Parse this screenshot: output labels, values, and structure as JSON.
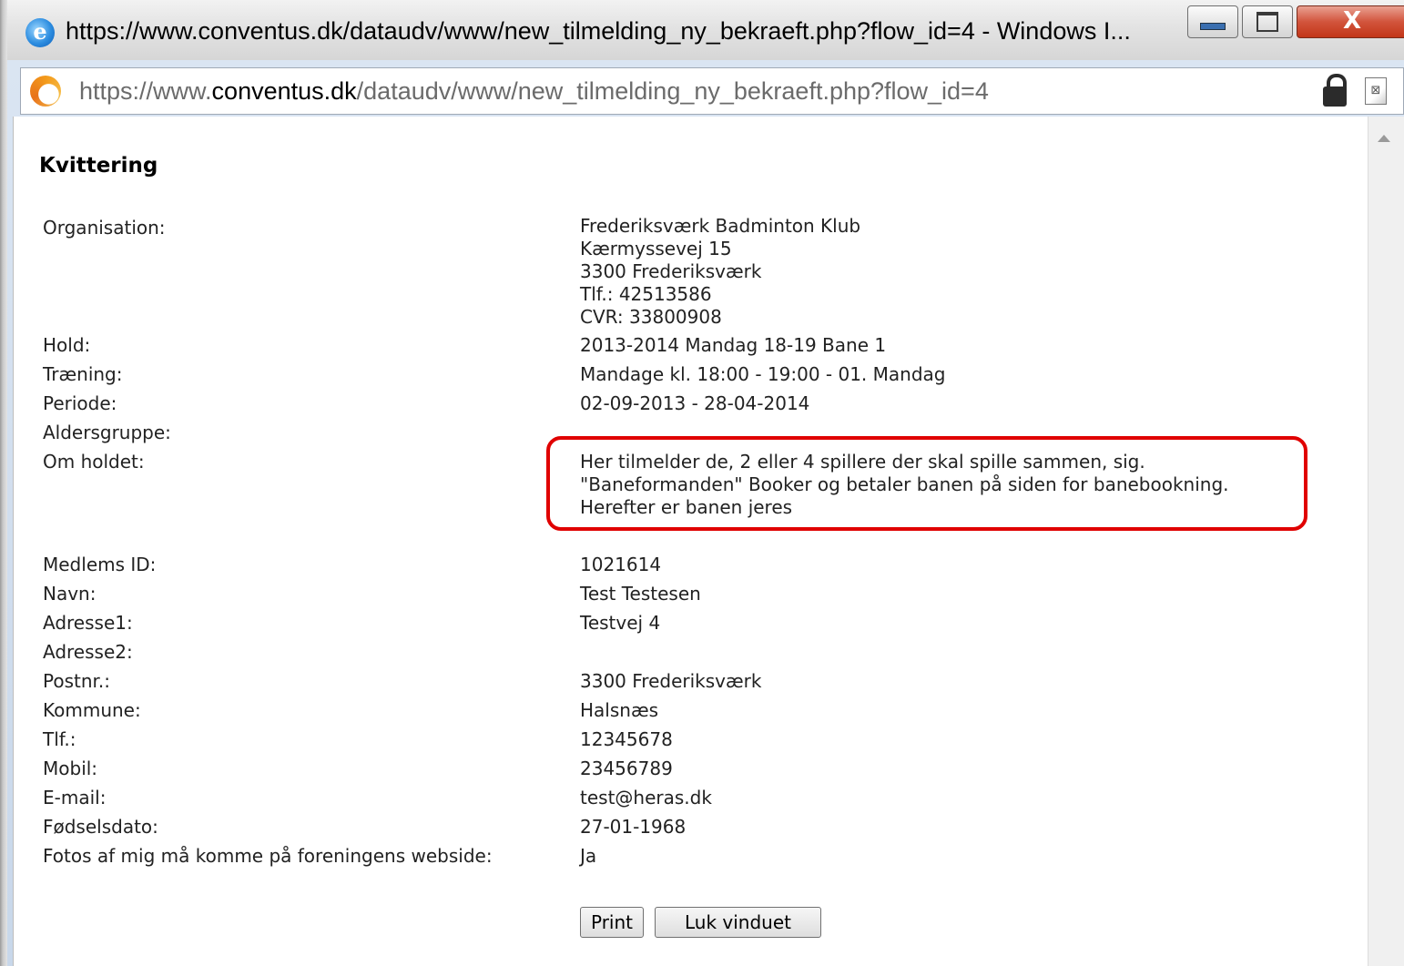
{
  "window": {
    "title": "https://www.conventus.dk/dataudv/www/new_tilmelding_ny_bekraeft.php?flow_id=4 - Windows I...",
    "close_glyph": "X"
  },
  "address": {
    "scheme": "https://www.",
    "domain": "conventus.dk",
    "path": "/dataudv/www/new_tilmelding_ny_bekraeft.php?flow_id=4"
  },
  "receipt": {
    "heading": "Kvittering",
    "organisation_label": "Organisation:",
    "organisation_lines": [
      "Frederiksværk Badminton Klub",
      "Kærmyssevej 15",
      "3300 Frederiksværk",
      "Tlf.: 42513586",
      "CVR: 33800908"
    ],
    "rows": [
      {
        "label": "Hold:",
        "value": "2013-2014 Mandag 18-19 Bane 1"
      },
      {
        "label": "Træning:",
        "value": "Mandage kl. 18:00 - 19:00 - 01. Mandag"
      },
      {
        "label": "Periode:",
        "value": "02-09-2013 - 28-04-2014"
      },
      {
        "label": "Aldersgruppe:",
        "value": ""
      }
    ],
    "om_holdet_label": "Om holdet:",
    "om_holdet_lines": [
      "Her tilmelder de, 2 eller 4 spillere der skal spille sammen, sig.",
      "\"Baneformanden\" Booker og betaler banen på siden for banebookning.",
      "Herefter er banen jeres"
    ],
    "member_rows": [
      {
        "label": "Medlems ID:",
        "value": "1021614"
      },
      {
        "label": "Navn:",
        "value": "Test Testesen"
      },
      {
        "label": "Adresse1:",
        "value": "Testvej 4"
      },
      {
        "label": "Adresse2:",
        "value": ""
      },
      {
        "label": "Postnr.:",
        "value": "3300 Frederiksværk"
      },
      {
        "label": "Kommune:",
        "value": "Halsnæs"
      },
      {
        "label": "Tlf.:",
        "value": "12345678"
      },
      {
        "label": "Mobil:",
        "value": "23456789"
      },
      {
        "label": "E-mail:",
        "value": "test@heras.dk"
      },
      {
        "label": "Fødselsdato:",
        "value": "27-01-1968"
      },
      {
        "label": "Fotos af mig må komme på foreningens webside:",
        "value": "Ja"
      }
    ]
  },
  "buttons": {
    "print": "Print",
    "close": "Luk vinduet"
  },
  "colors": {
    "highlight": "#e00000"
  }
}
